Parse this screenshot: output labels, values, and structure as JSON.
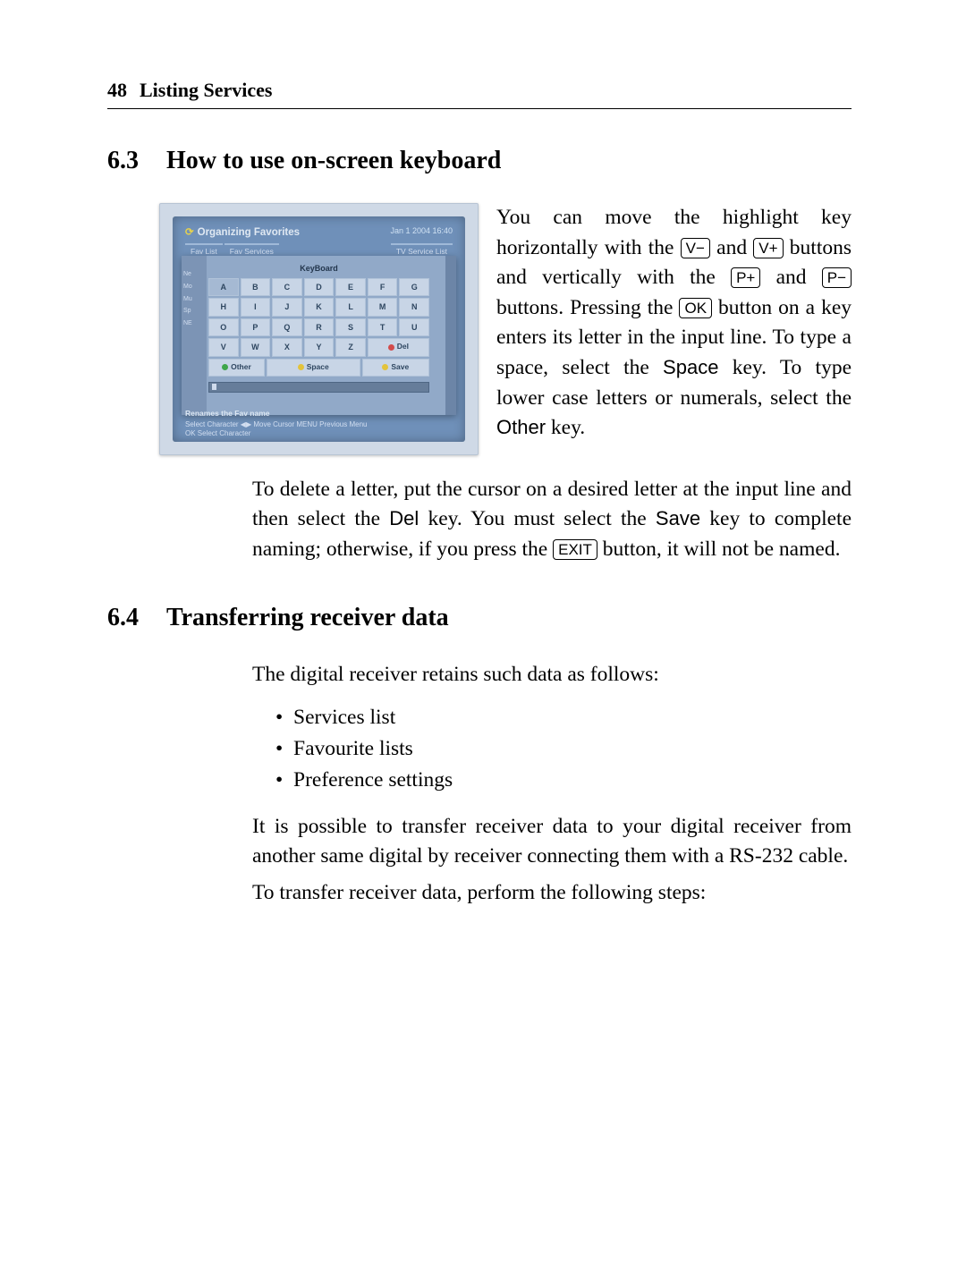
{
  "header": {
    "page_number": "48",
    "chapter_title": "Listing Services"
  },
  "section63": {
    "number": "6.3",
    "title": "How to use on-screen keyboard",
    "para_a": "You can move the highlight key horizontally with the ",
    "key_vminus": "V−",
    "para_b": " and ",
    "key_vplus": "V+",
    "para_c": " buttons and vertically with the ",
    "key_pplus": "P+",
    "para_d": " and ",
    "key_pminus": "P−",
    "para_e": " buttons. Pressing the ",
    "key_ok": "OK",
    "para_f": " button on a key enters its letter in the input line. To type a space, select the ",
    "word_space": "Space",
    "para_g": " key. To type lower case letters or numerals, select the ",
    "word_other": "Other",
    "para_h": " key.",
    "p2_a": "To delete a letter, put the cursor on a desired letter at the input line and then select the ",
    "word_del": "Del",
    "p2_b": " key. You must select the ",
    "word_save": "Save",
    "p2_c": " key to complete naming; otherwise, if you press the ",
    "key_exit": "EXIT",
    "p2_d": " button, it will not be named."
  },
  "section64": {
    "number": "6.4",
    "title": "Transferring receiver data",
    "intro": "The digital receiver retains such data as follows:",
    "bullets": [
      "Services list",
      "Favourite lists",
      "Preference settings"
    ],
    "p2": "It is possible to transfer receiver data to your digital receiver from another same digital by receiver connecting them with a RS-232 cable.",
    "p3": "To transfer receiver data, perform the following steps:"
  },
  "screenshot": {
    "title": "Organizing Favorites",
    "datetime": "Jan 1 2004 16:40",
    "tabs": [
      "Fav List",
      "Fav Services",
      "TV Service List"
    ],
    "sidebar": [
      "Ne",
      "Mo",
      "Mu",
      "Sp",
      "NE"
    ],
    "kb_title": "KeyBoard",
    "row1": [
      "A",
      "B",
      "C",
      "D",
      "E",
      "F",
      "G"
    ],
    "row2": [
      "H",
      "I",
      "J",
      "K",
      "L",
      "M",
      "N"
    ],
    "row3": [
      "O",
      "P",
      "Q",
      "R",
      "S",
      "T",
      "U"
    ],
    "row4": [
      "V",
      "W",
      "X",
      "Y",
      "Z"
    ],
    "del": "Del",
    "other": "Other",
    "space": "Space",
    "save": "Save",
    "footer_title": "Renames the Fav name",
    "footer_line1": "Select Character ◀▶ Move Cursor MENU Previous Menu",
    "footer_line2": "OK Select Character"
  }
}
